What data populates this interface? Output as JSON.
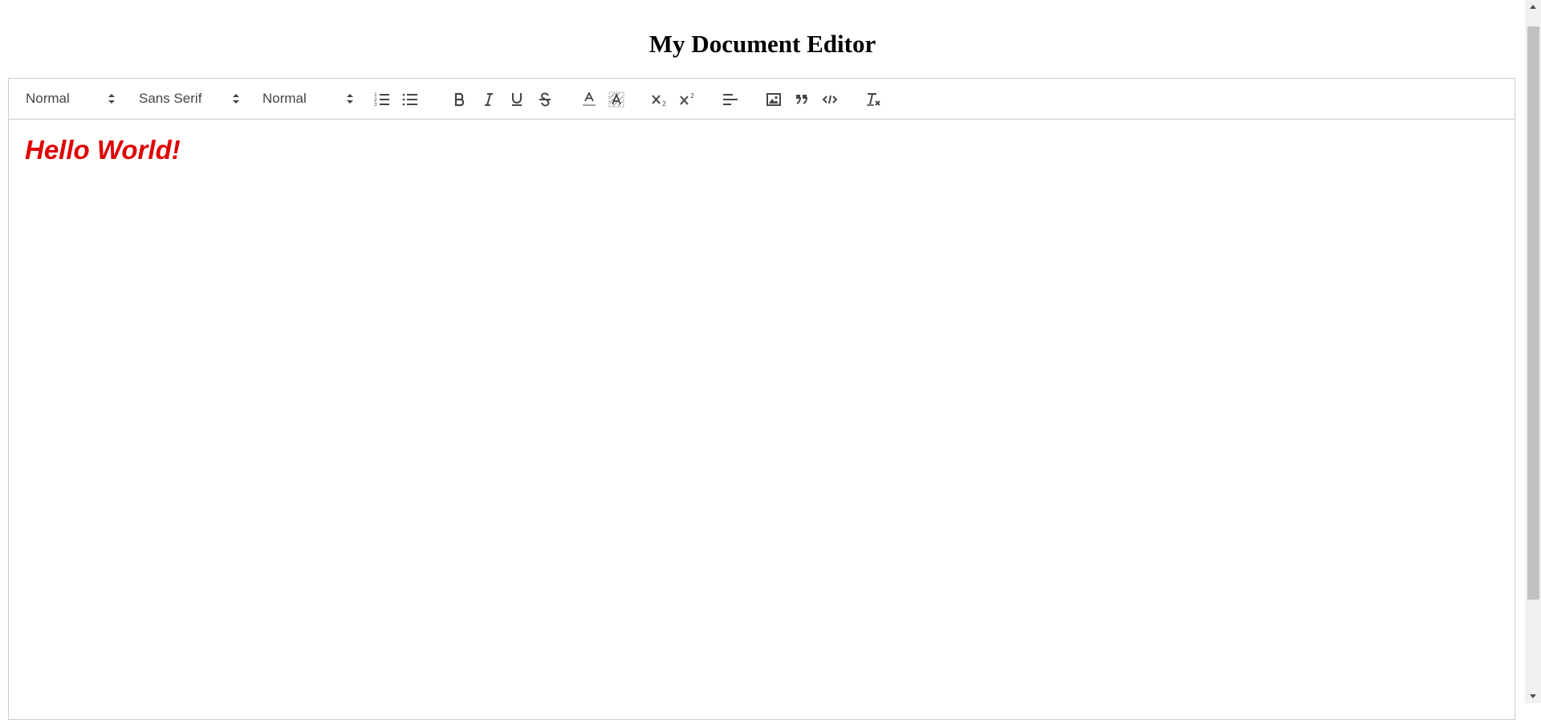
{
  "page": {
    "title": "My Document Editor"
  },
  "toolbar": {
    "header_picker": "Normal",
    "font_picker": "Sans Serif",
    "size_picker": "Normal",
    "buttons": [
      "ordered-list-icon",
      "bullet-list-icon",
      "bold-icon",
      "italic-icon",
      "underline-icon",
      "strike-icon",
      "text-color-icon",
      "background-color-icon",
      "subscript-icon",
      "superscript-icon",
      "align-icon",
      "image-icon",
      "blockquote-icon",
      "code-block-icon",
      "clean-format-icon"
    ]
  },
  "editor": {
    "content": "Hello World!",
    "text_color": "#e00000"
  },
  "colors": {
    "border": "#cccccc",
    "icon": "#444444",
    "scrollbar_track": "#f1f1f1",
    "scrollbar_thumb": "#c1c1c1"
  }
}
